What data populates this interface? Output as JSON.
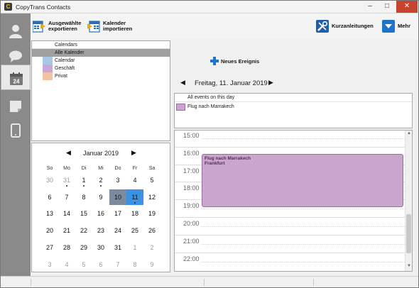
{
  "window": {
    "title": "CopyTrans Contacts",
    "icon": "C"
  },
  "toolbar": {
    "export_label": "Ausgewählte\nexportieren",
    "import_label": "Kalender\nimportieren",
    "shortcuts_label": "Kurzanleitungen",
    "more_label": "Mehr"
  },
  "calendars": {
    "header": "Calendars",
    "items": [
      {
        "label": "Alle Kalender",
        "color": "#a0a0a0",
        "selected": true
      },
      {
        "label": "Calendar",
        "color": "#a8c8e8",
        "selected": false
      },
      {
        "label": "Geschäft",
        "color": "#c8a8d8",
        "selected": false
      },
      {
        "label": "Privat",
        "color": "#f3c1a3",
        "selected": false
      }
    ]
  },
  "mini_calendar": {
    "title": "Januar 2019",
    "weekdays": [
      "So",
      "Mo",
      "Di",
      "Mi",
      "Do",
      "Fr",
      "Sa"
    ],
    "weeks": [
      [
        {
          "d": "30",
          "o": true
        },
        {
          "d": "31",
          "o": true,
          "dot": true
        },
        {
          "d": "1",
          "dot": true
        },
        {
          "d": "2",
          "dot": true
        },
        {
          "d": "3"
        },
        {
          "d": "4"
        },
        {
          "d": "5"
        }
      ],
      [
        {
          "d": "6"
        },
        {
          "d": "7"
        },
        {
          "d": "8"
        },
        {
          "d": "9"
        },
        {
          "d": "10",
          "sel": true
        },
        {
          "d": "11",
          "today": true,
          "dot": true
        },
        {
          "d": "12"
        }
      ],
      [
        {
          "d": "13"
        },
        {
          "d": "14"
        },
        {
          "d": "15"
        },
        {
          "d": "16"
        },
        {
          "d": "17"
        },
        {
          "d": "18"
        },
        {
          "d": "19"
        }
      ],
      [
        {
          "d": "20"
        },
        {
          "d": "21"
        },
        {
          "d": "22"
        },
        {
          "d": "23"
        },
        {
          "d": "24"
        },
        {
          "d": "25"
        },
        {
          "d": "26"
        }
      ],
      [
        {
          "d": "27"
        },
        {
          "d": "28"
        },
        {
          "d": "29"
        },
        {
          "d": "30"
        },
        {
          "d": "31"
        },
        {
          "d": "1",
          "o": true
        },
        {
          "d": "2",
          "o": true
        }
      ],
      [
        {
          "d": "3",
          "o": true
        },
        {
          "d": "4",
          "o": true
        },
        {
          "d": "5",
          "o": true
        },
        {
          "d": "6",
          "o": true
        },
        {
          "d": "7",
          "o": true
        },
        {
          "d": "8",
          "o": true
        },
        {
          "d": "9",
          "o": true
        }
      ]
    ]
  },
  "actions": {
    "new_event_label": "Neues Ereignis"
  },
  "day_view": {
    "date_label": "Freitag, 11. Januar 2019",
    "all_day_header": "All events on this day",
    "all_day_events": [
      {
        "label": "Flug nach Marrakech",
        "color": "#c9a7cd"
      }
    ],
    "hours": [
      "15:00",
      "16:00",
      "17:00",
      "18:00",
      "19:00",
      "20:00",
      "21:00",
      "22:00"
    ],
    "event": {
      "title": "Flug nach Marrakech",
      "location": "Frankfurt"
    }
  }
}
